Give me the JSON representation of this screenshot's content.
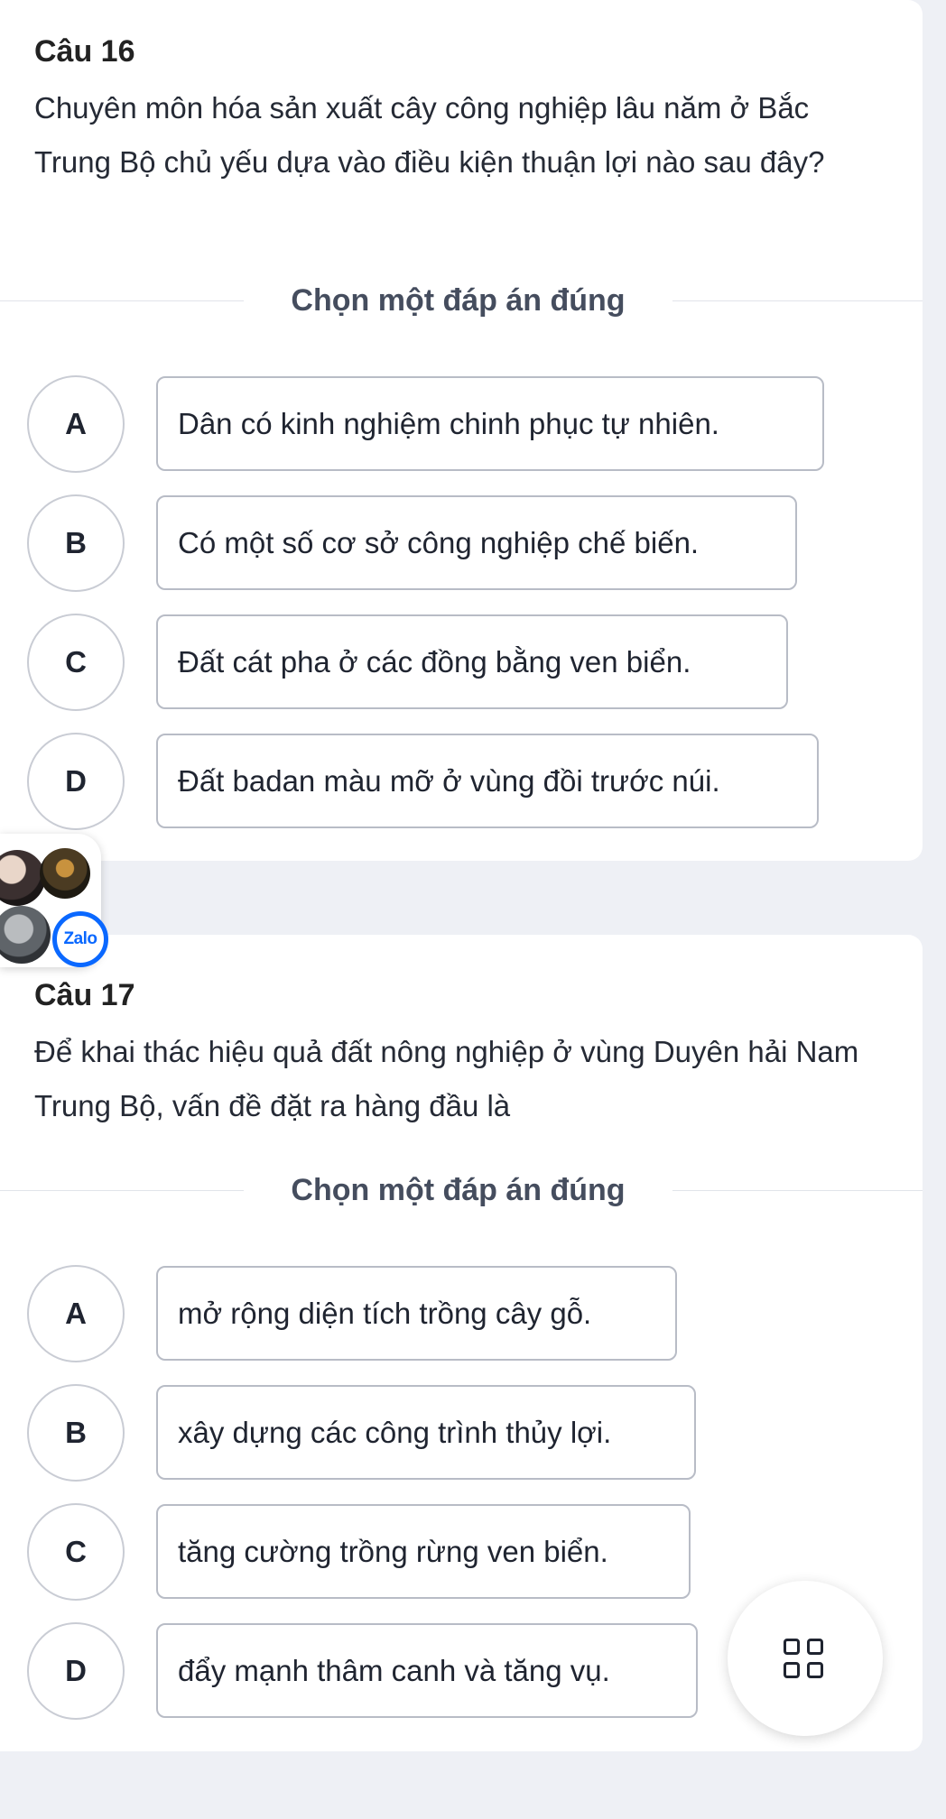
{
  "questions": [
    {
      "title": "Câu 16",
      "text": "Chuyên môn hóa sản xuất cây công nghiệp lâu năm ở Bắc Trung Bộ chủ yếu dựa vào điều kiện thuận lợi nào sau đây?",
      "instruction": "Chọn một đáp án đúng",
      "options": [
        {
          "letter": "A",
          "text": "Dân có kinh nghiệm chinh phục tự nhiên."
        },
        {
          "letter": "B",
          "text": "Có một số cơ sở công nghiệp chế biến."
        },
        {
          "letter": "C",
          "text": "Đất cát pha ở các đồng bằng ven biển."
        },
        {
          "letter": "D",
          "text": "Đất badan màu mỡ ở vùng đồi trước núi."
        }
      ]
    },
    {
      "title": "Câu 17",
      "text": "Để khai thác hiệu quả đất nông nghiệp ở vùng Duyên hải Nam Trung Bộ, vấn đề đặt ra hàng đầu là",
      "instruction": "Chọn một đáp án đúng",
      "options": [
        {
          "letter": "A",
          "text": "mở rộng diện tích trồng cây gỗ."
        },
        {
          "letter": "B",
          "text": "xây dựng các công trình thủy lợi."
        },
        {
          "letter": "C",
          "text": "tăng cường trồng rừng ven biển."
        },
        {
          "letter": "D",
          "text": "đẩy mạnh thâm canh và tăng vụ."
        }
      ]
    }
  ],
  "zalo": {
    "label": "Zalo",
    "brand_color": "#0a68ff"
  },
  "icons": {
    "grid": "grid-menu-icon"
  }
}
